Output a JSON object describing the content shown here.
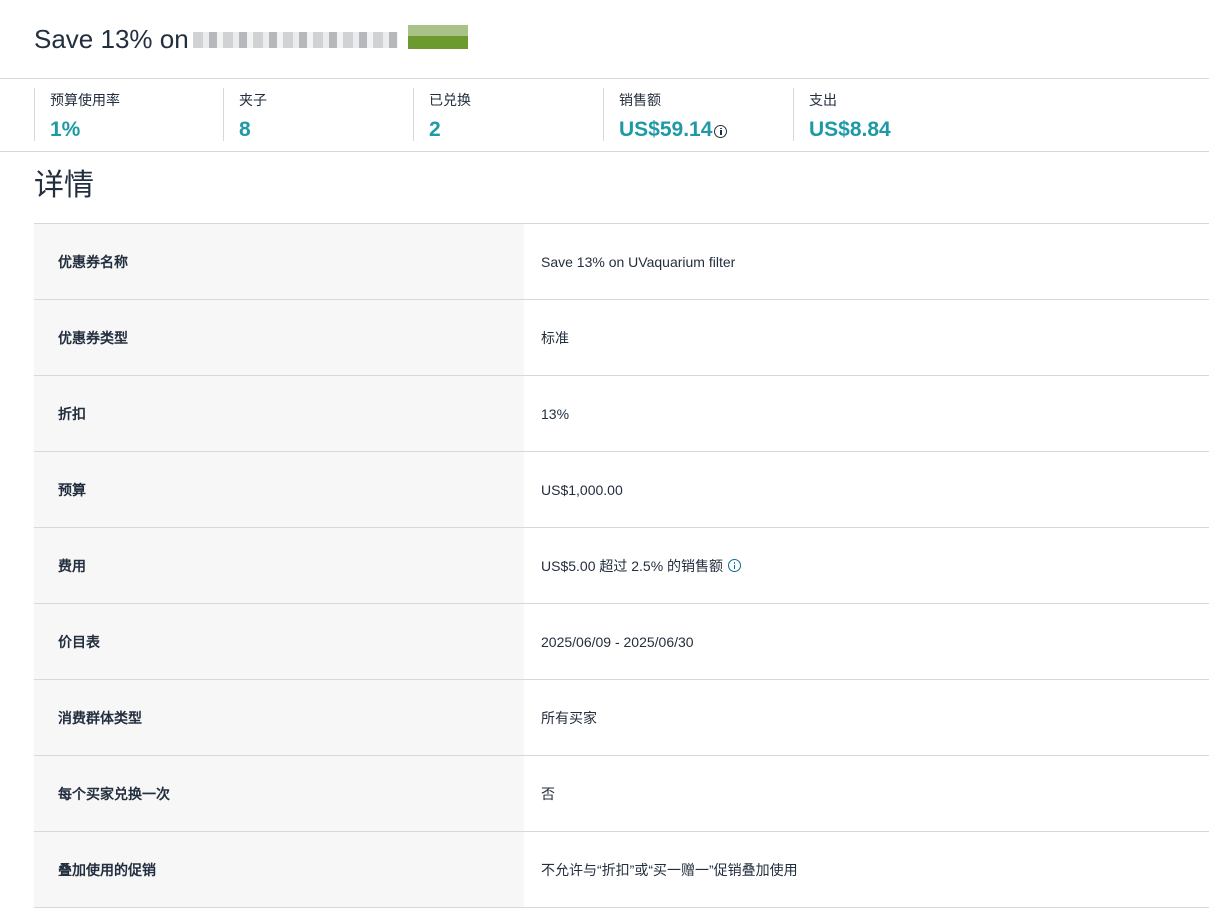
{
  "header": {
    "title": "Save 13% on"
  },
  "metrics": [
    {
      "label": "预算使用率",
      "value": "1%"
    },
    {
      "label": "夹子",
      "value": "8"
    },
    {
      "label": "已兑换",
      "value": "2"
    },
    {
      "label": "销售额",
      "value": "US$59.14",
      "info_icon": "info-icon"
    },
    {
      "label": "支出",
      "value": "US$8.84"
    }
  ],
  "details": {
    "title": "详情",
    "rows": [
      {
        "key": "优惠券名称",
        "value": "Save 13% on UVaquarium filter"
      },
      {
        "key": "优惠券类型",
        "value": "标准"
      },
      {
        "key": "折扣",
        "value": "13%"
      },
      {
        "key": "预算",
        "value": "US$1,000.00"
      },
      {
        "key": "费用",
        "value": "US$5.00 超过 2.5% 的销售额",
        "info_icon": "info-icon"
      },
      {
        "key": "价目表",
        "value": "2025/06/09 - 2025/06/30"
      },
      {
        "key": "消费群体类型",
        "value": "所有买家"
      },
      {
        "key": "每个买家兑换一次",
        "value": "否"
      },
      {
        "key": "叠加使用的促销",
        "value": "不允许与“折扣”或“买一赠一”促销叠加使用"
      }
    ]
  },
  "colors": {
    "accent": "#1e9aa6",
    "text": "#232f3e",
    "info_link": "#0a6f9a",
    "row_label_bg": "#f7f7f7",
    "divider": "#d5d9d9"
  }
}
